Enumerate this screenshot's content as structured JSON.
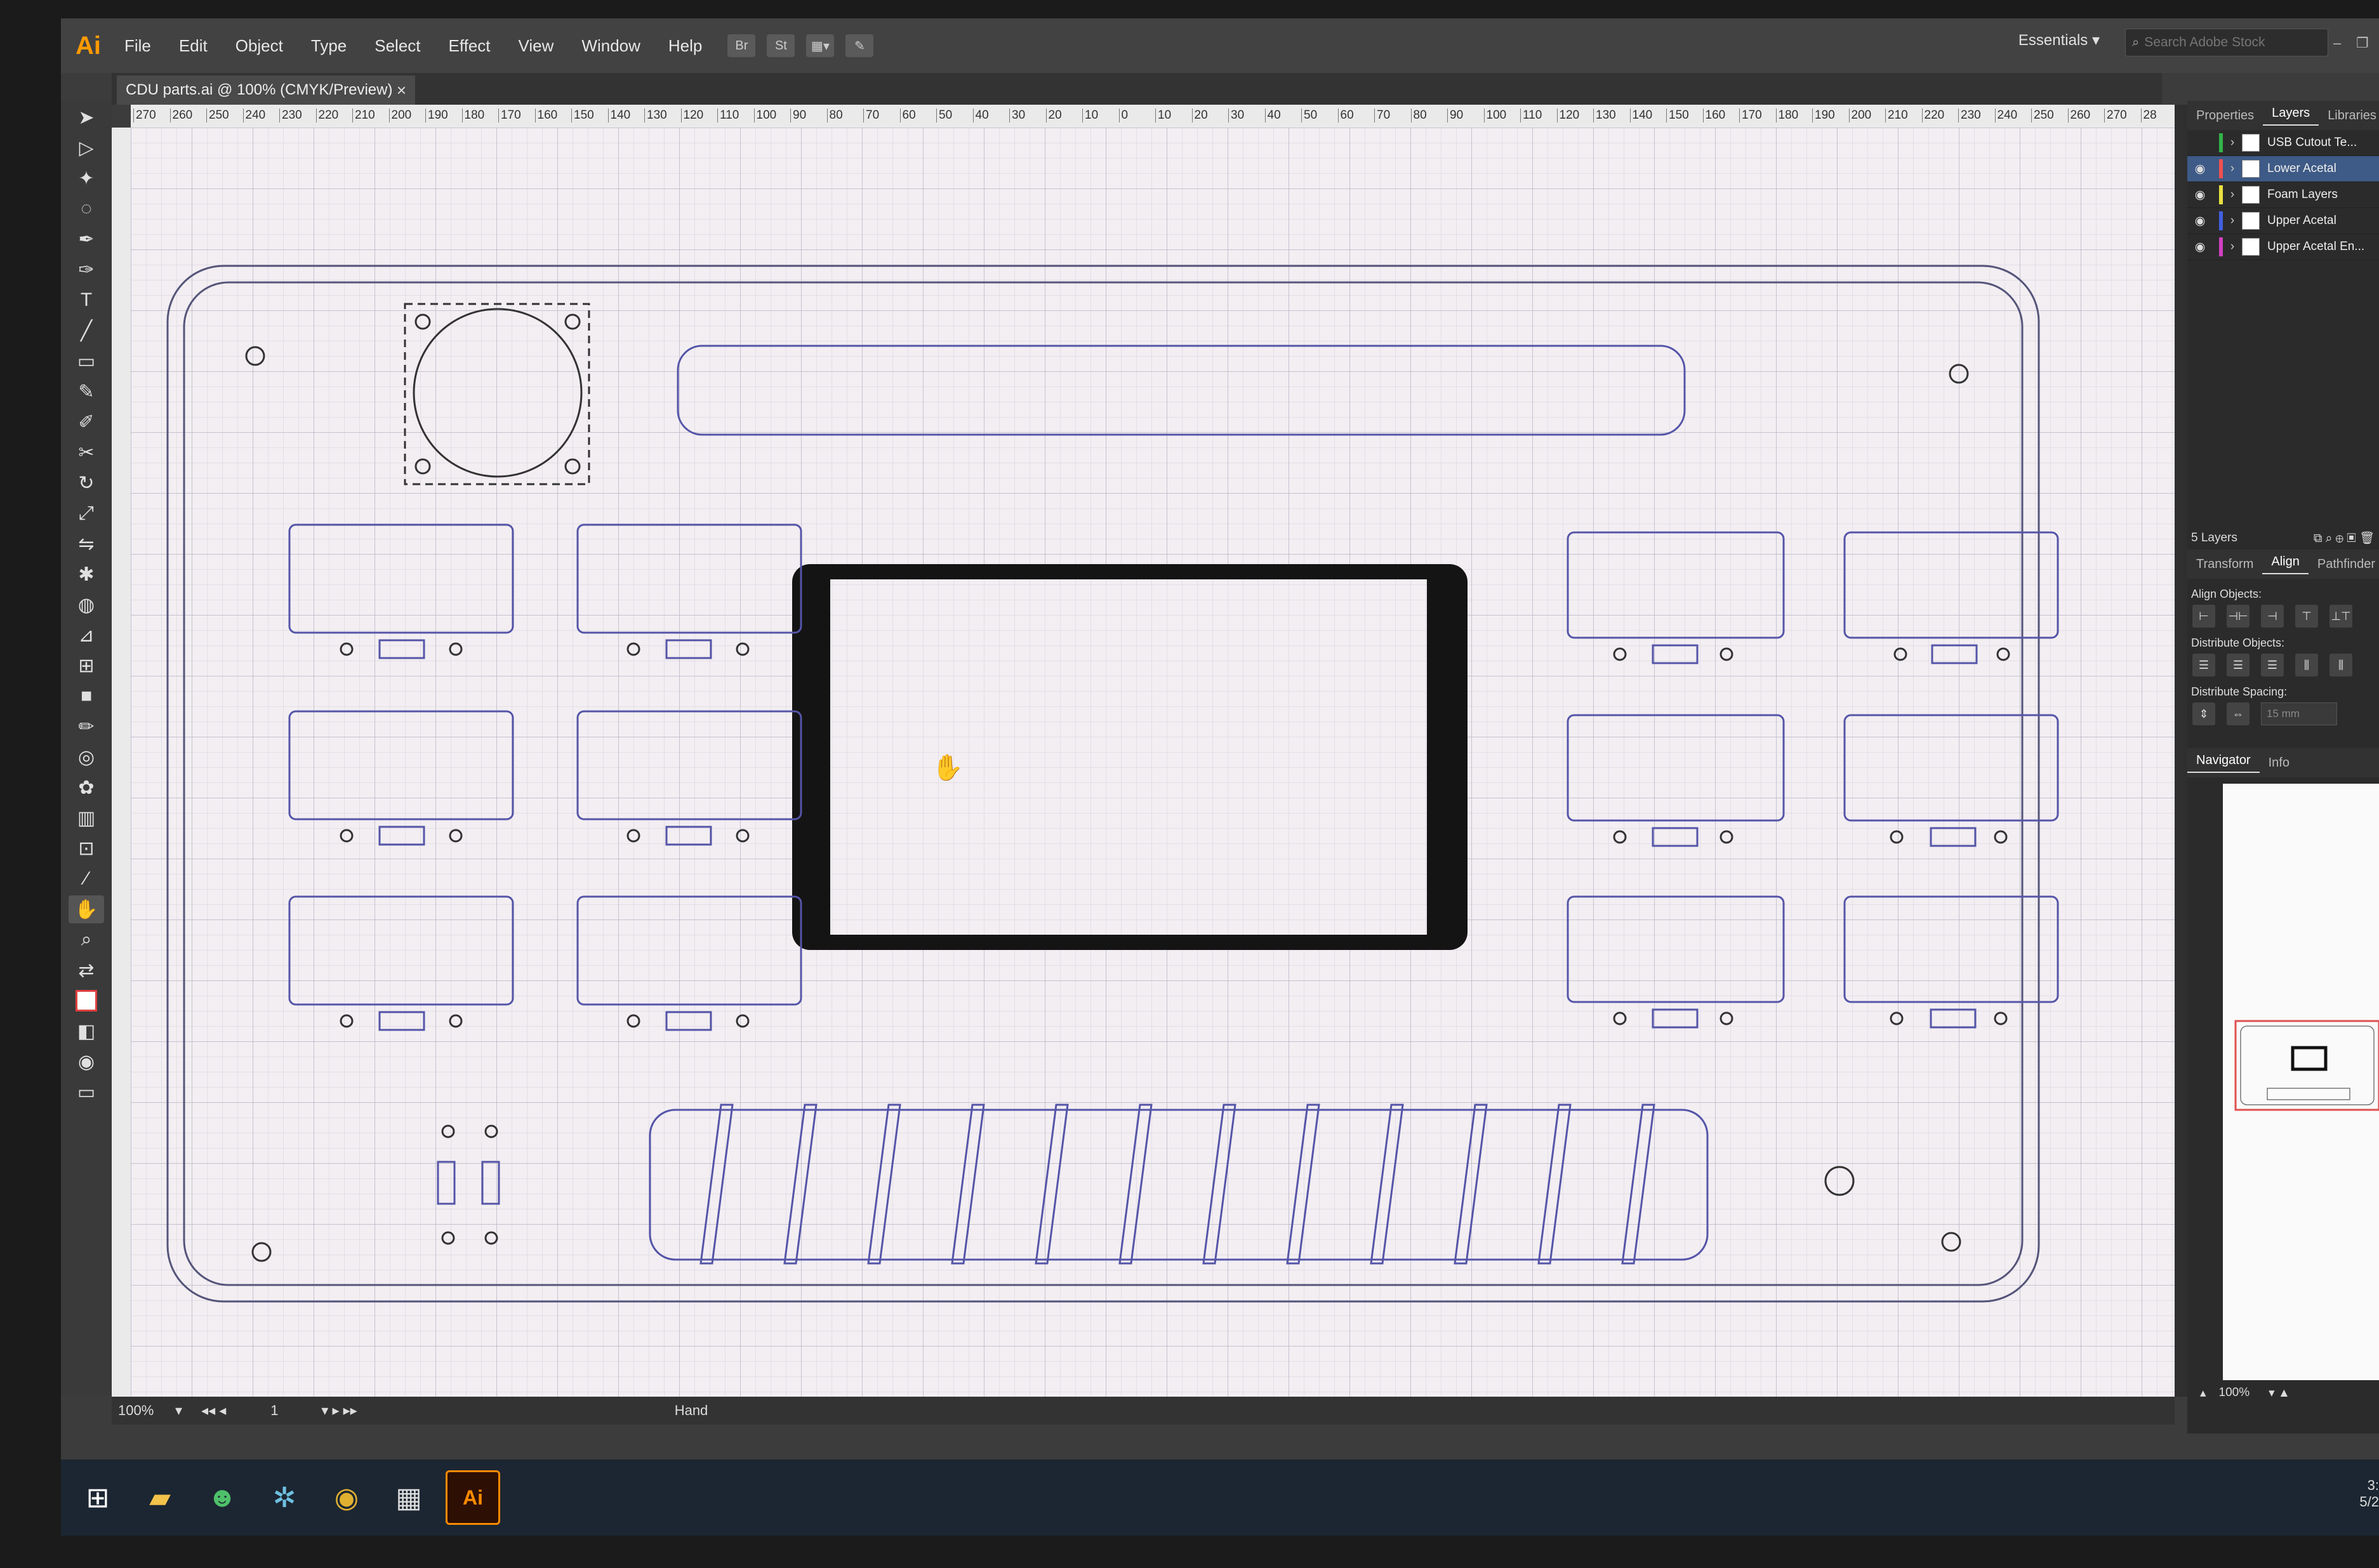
{
  "app": {
    "logo": "Ai"
  },
  "menu": [
    "File",
    "Edit",
    "Object",
    "Type",
    "Select",
    "Effect",
    "View",
    "Window",
    "Help"
  ],
  "menu_icons": [
    "Br",
    "St",
    "arrange-docs-icon",
    "gpu-performance-icon"
  ],
  "workspace": "Essentials",
  "stock_search": {
    "placeholder": "Search Adobe Stock"
  },
  "document_tab": {
    "title": "CDU parts.ai @ 100% (CMYK/Preview)",
    "close": "×"
  },
  "ruler_top_labels": [
    "270",
    "260",
    "250",
    "240",
    "230",
    "220",
    "210",
    "200",
    "190",
    "180",
    "170",
    "160",
    "150",
    "140",
    "130",
    "120",
    "110",
    "100",
    "90",
    "80",
    "70",
    "60",
    "50",
    "40",
    "30",
    "20",
    "10",
    "0",
    "10",
    "20",
    "30",
    "40",
    "50",
    "60",
    "70",
    "80",
    "90",
    "100",
    "110",
    "120",
    "130",
    "140",
    "150",
    "160",
    "170",
    "180",
    "190",
    "200",
    "210",
    "220",
    "230",
    "240",
    "250",
    "260",
    "270",
    "28"
  ],
  "status": {
    "zoom": "100%",
    "artboard": "1",
    "tool": "Hand"
  },
  "panel_tabs": [
    "Properties",
    "Layers",
    "Libraries"
  ],
  "layers": [
    {
      "name": "USB Cutout Te...",
      "color": "#32b34a",
      "visible": false,
      "selected": false
    },
    {
      "name": "Lower Acetal",
      "color": "#f05050",
      "visible": true,
      "selected": true
    },
    {
      "name": "Foam Layers",
      "color": "#e8e040",
      "visible": true,
      "selected": false
    },
    {
      "name": "Upper Acetal",
      "color": "#4060e0",
      "visible": true,
      "selected": false
    },
    {
      "name": "Upper Acetal En...",
      "color": "#d040c0",
      "visible": true,
      "selected": false
    }
  ],
  "layers_count": "5 Layers",
  "align_tabs": [
    "Transform",
    "Align",
    "Pathfinder"
  ],
  "align": {
    "align_objects": "Align Objects:",
    "distribute_objects": "Distribute Objects:",
    "distribute_spacing": "Distribute Spacing:",
    "spacing_value": "15 mm"
  },
  "navigator_tabs": [
    "Navigator",
    "Info"
  ],
  "navigator_zoom": "100%",
  "taskbar": {
    "apps": [
      "windows-start-icon",
      "file-explorer-icon",
      "app-green-icon",
      "app-slack-icon",
      "chrome-icon",
      "calculator-icon",
      "Ai"
    ]
  },
  "tray": {
    "time": "3:",
    "date": "5/2"
  }
}
